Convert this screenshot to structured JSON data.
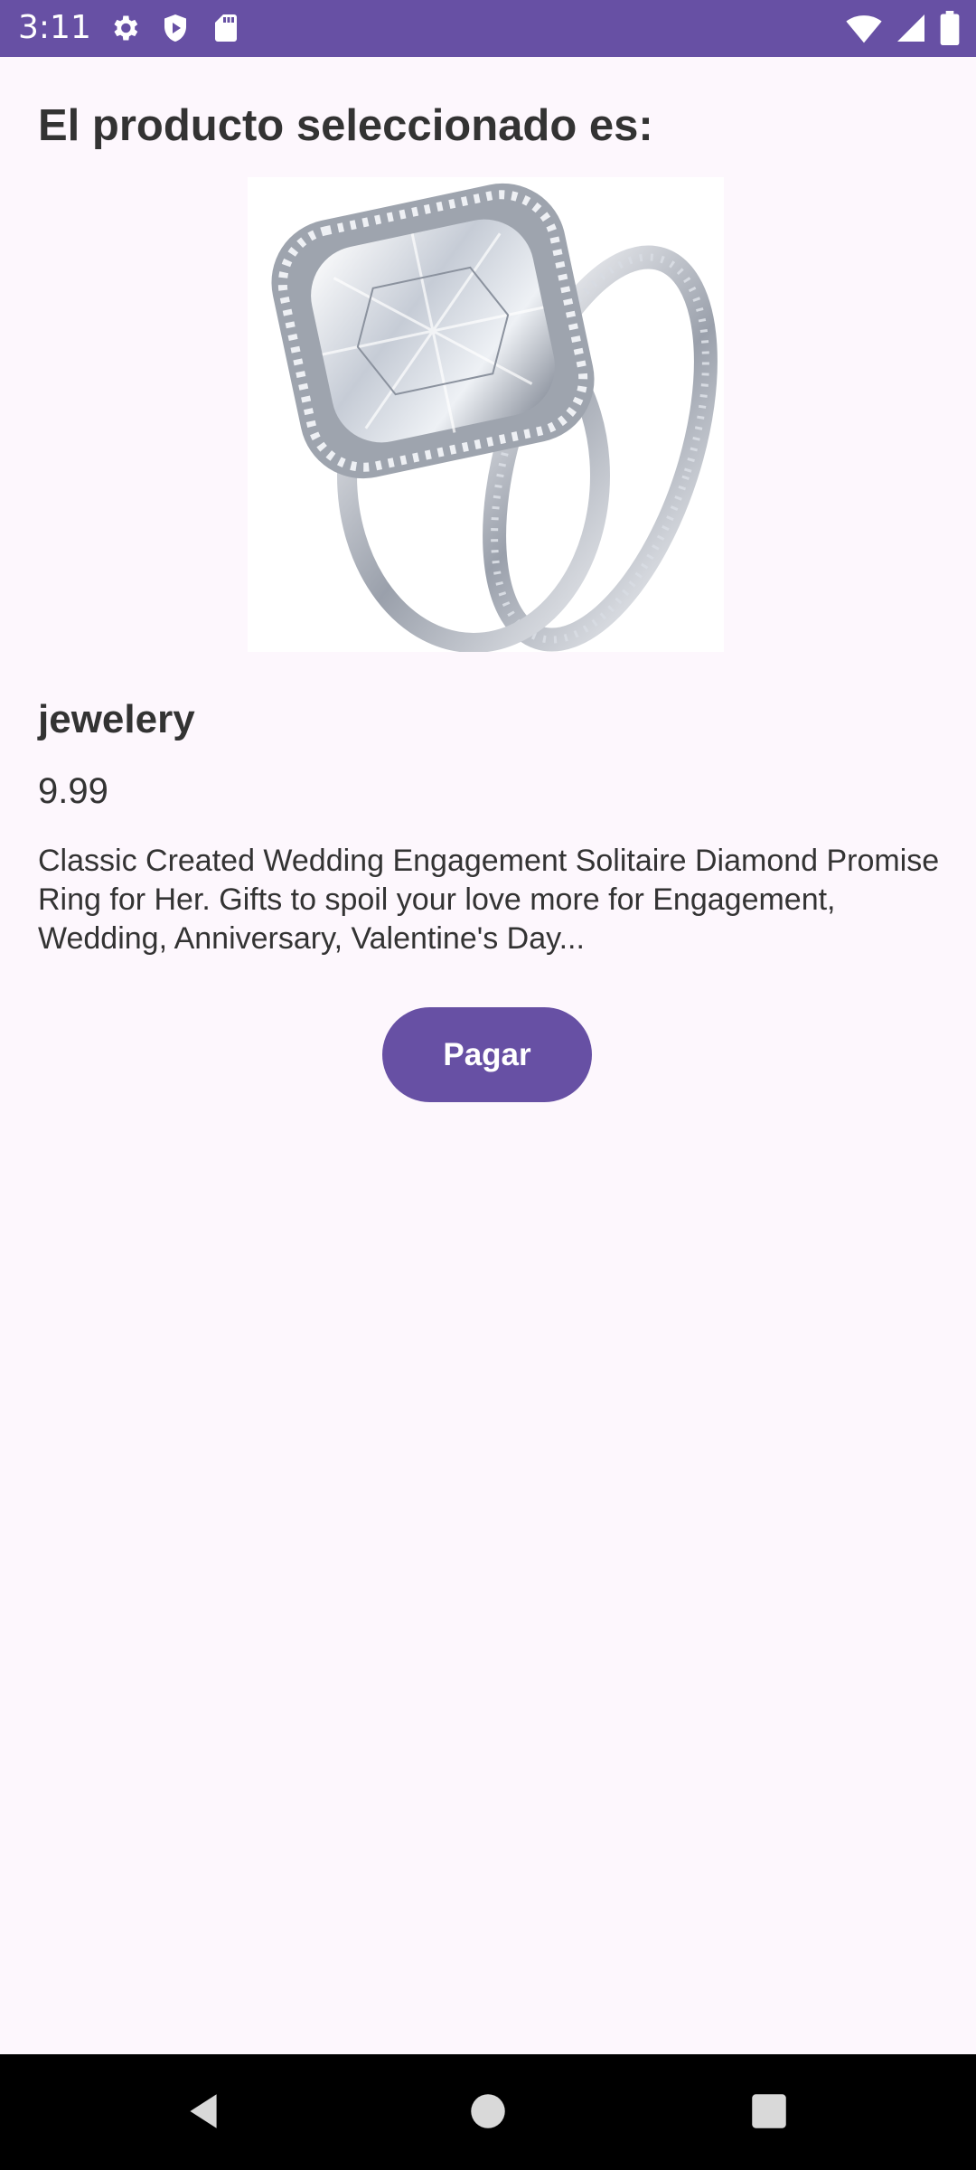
{
  "status_bar": {
    "time": "3:11",
    "left_icons": [
      "settings-icon",
      "shield-icon",
      "sd-card-icon"
    ],
    "right_icons": [
      "wifi-icon",
      "signal-icon",
      "battery-icon"
    ],
    "color": "#6750A4"
  },
  "main": {
    "heading": "El producto seleccionado es:",
    "product": {
      "image": "diamond-ring-image",
      "title": "jewelery",
      "price": "9.99",
      "description": "Classic Created Wedding Engagement Solitaire Diamond Promise Ring for Her. Gifts to spoil your love more for Engagement, Wedding, Anniversary, Valentine's Day..."
    },
    "pay_button_label": "Pagar",
    "accent_color": "#6750A4"
  },
  "nav_bar": {
    "buttons": [
      "back-icon",
      "home-icon",
      "recents-icon"
    ]
  }
}
